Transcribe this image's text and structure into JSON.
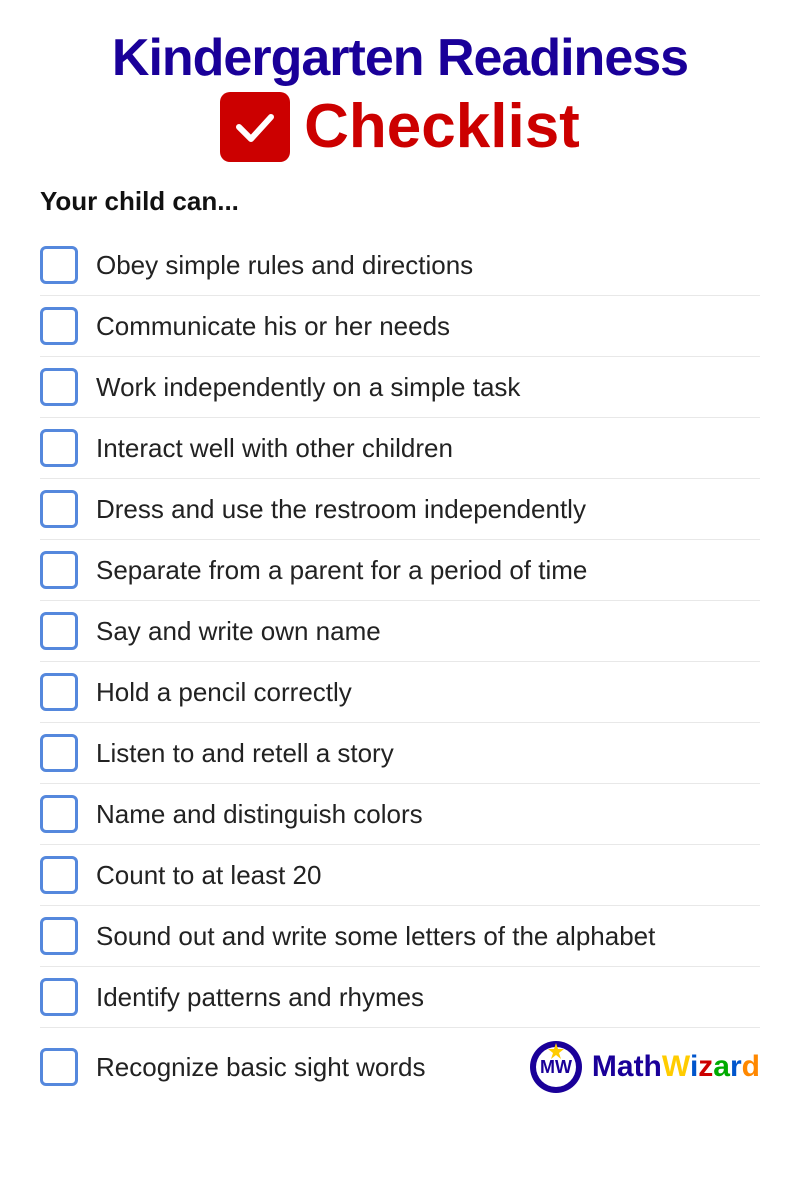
{
  "header": {
    "title_line1": "Kindergarten Readiness",
    "title_line2_word": "Checklist"
  },
  "subtitle": "Your child can...",
  "items": [
    {
      "id": 1,
      "text": "Obey simple rules and directions"
    },
    {
      "id": 2,
      "text": "Communicate his or her needs"
    },
    {
      "id": 3,
      "text": "Work independently on a simple task"
    },
    {
      "id": 4,
      "text": "Interact well with other children"
    },
    {
      "id": 5,
      "text": "Dress and use the restroom independently"
    },
    {
      "id": 6,
      "text": "Separate from a parent for a period of time"
    },
    {
      "id": 7,
      "text": "Say and write own name"
    },
    {
      "id": 8,
      "text": "Hold a pencil correctly"
    },
    {
      "id": 9,
      "text": "Listen to and retell a story"
    },
    {
      "id": 10,
      "text": "Name and distinguish colors"
    },
    {
      "id": 11,
      "text": "Count to at least 20"
    },
    {
      "id": 12,
      "text": "Sound out and write some letters of the alphabet"
    },
    {
      "id": 13,
      "text": "Identify patterns and rhymes"
    },
    {
      "id": 14,
      "text": "Recognize basic sight words"
    }
  ],
  "branding": {
    "math": "Math",
    "wizard": "Wizard"
  }
}
